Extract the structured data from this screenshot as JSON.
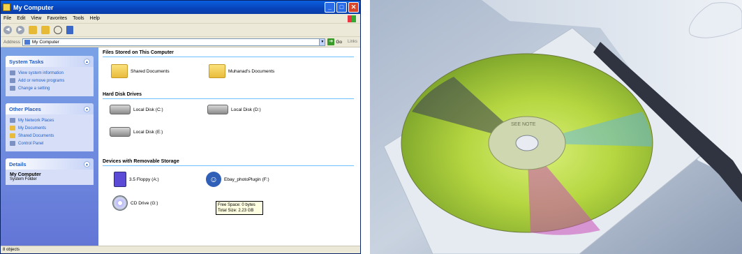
{
  "window": {
    "title": "My Computer",
    "controls": {
      "minimize": "_",
      "maximize": "□",
      "close": "✕"
    }
  },
  "menu": [
    "File",
    "Edit",
    "View",
    "Favorites",
    "Tools",
    "Help"
  ],
  "toolbar": {
    "icons": [
      "back-icon",
      "forward-icon",
      "up-folder-icon",
      "folders-icon",
      "search-icon",
      "views-icon"
    ]
  },
  "address": {
    "label": "Address",
    "value": "My Computer",
    "go": "Go",
    "links": "Links"
  },
  "side_panel": {
    "system_tasks": {
      "title": "System Tasks",
      "items": [
        "View system information",
        "Add or remove programs",
        "Change a setting"
      ]
    },
    "other_places": {
      "title": "Other Places",
      "items": [
        "My Network Places",
        "My Documents",
        "Shared Documents",
        "Control Panel"
      ]
    },
    "details": {
      "title": "Details",
      "name": "My Computer",
      "type": "System Folder"
    }
  },
  "content": {
    "groups": [
      {
        "title": "Files Stored on This Computer",
        "items": [
          "Shared Documents",
          "Muhanad's Documents"
        ]
      },
      {
        "title": "Hard Disk Drives",
        "items": [
          "Local Disk (C:)",
          "Local Disk (D:)",
          "Local Disk (E:)"
        ]
      },
      {
        "title": "Devices with Removable Storage",
        "items": [
          "3.5 Floppy (A:)",
          "Ebay_photoPlugin (F:)",
          "CD Drive (G:)"
        ]
      }
    ],
    "tooltip": {
      "free": "Free Space: 0 bytes",
      "total": "Total Size: 2.23 GB"
    }
  },
  "status_bar": "8 objects",
  "photo": {
    "disc_label": "SEE NOTE"
  }
}
